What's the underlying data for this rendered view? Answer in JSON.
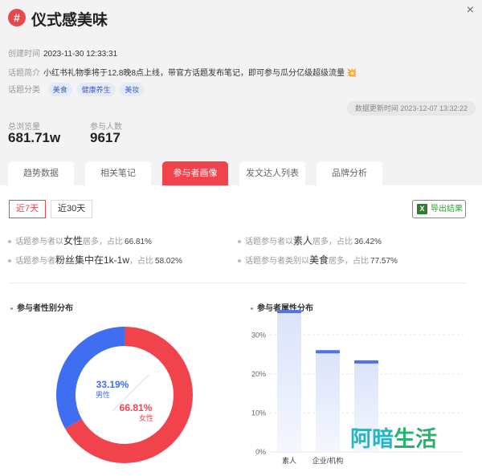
{
  "header": {
    "icon_symbol": "#",
    "title": "仪式感美味",
    "close_symbol": "×"
  },
  "meta": {
    "created_label": "创建时间",
    "created_value": "2023-11-30 12:33:31",
    "intro_label": "话题简介",
    "intro_value": "小红书礼物季将于12.8晚8点上线，带官方话题发布笔记，即可参与瓜分亿级超级流量",
    "intro_emoji": "💥",
    "category_label": "话题分类",
    "category_tags": [
      "美食",
      "健康养生",
      "美妆"
    ]
  },
  "update": {
    "text": "数据更新时间 2023-12-07 13:32:22"
  },
  "stats": {
    "views_label": "总浏览量",
    "views_value": "681.71w",
    "participants_label": "参与人数",
    "participants_value": "9617"
  },
  "tabs": [
    "趋势数据",
    "相关笔记",
    "参与者画像",
    "发文达人列表",
    "品牌分析"
  ],
  "active_tab": 2,
  "period": {
    "options": [
      "近7天",
      "近30天"
    ],
    "selected": 0
  },
  "export": {
    "label": "导出结果",
    "icon": "excel-icon"
  },
  "insights": {
    "i1": {
      "prefix": "话题参与者以",
      "key": "女性",
      "mid": "居多，占比",
      "pct": "66.81%"
    },
    "i2": {
      "prefix": "话题参与者以",
      "key": "素人",
      "mid": "居多，占比",
      "pct": "36.42%"
    },
    "i3": {
      "prefix": "话题参与者",
      "key": "粉丝集中在1k-1w",
      "mid": "，占比",
      "pct": "58.02%"
    },
    "i4": {
      "prefix": "话题参与者类别以",
      "key": "美食",
      "mid": "居多，占比",
      "pct": "77.57%"
    }
  },
  "gender_chart": {
    "title": "参与者性别分布",
    "male_pct": "33.19%",
    "male_label": "男性",
    "male_value": 33.19,
    "male_color": "#3f6ff0",
    "female_pct": "66.81%",
    "female_label": "女性",
    "female_value": 66.81,
    "female_color": "#f0434c"
  },
  "attr_chart": {
    "title": "参与者属性分布",
    "chart_data": {
      "type": "bar",
      "categories": [
        "素人",
        "企业/机构",
        ""
      ],
      "values": [
        36.42,
        26.1,
        23.5
      ],
      "ylim": [
        0,
        35
      ],
      "ticks": [
        "0%",
        "10%",
        "20%",
        "30%"
      ],
      "tick_values": [
        0,
        10,
        20,
        30
      ],
      "bar_color": "#4f73e0"
    }
  },
  "watermark": {
    "chars": [
      "阿",
      "暗",
      "生",
      "活"
    ]
  }
}
